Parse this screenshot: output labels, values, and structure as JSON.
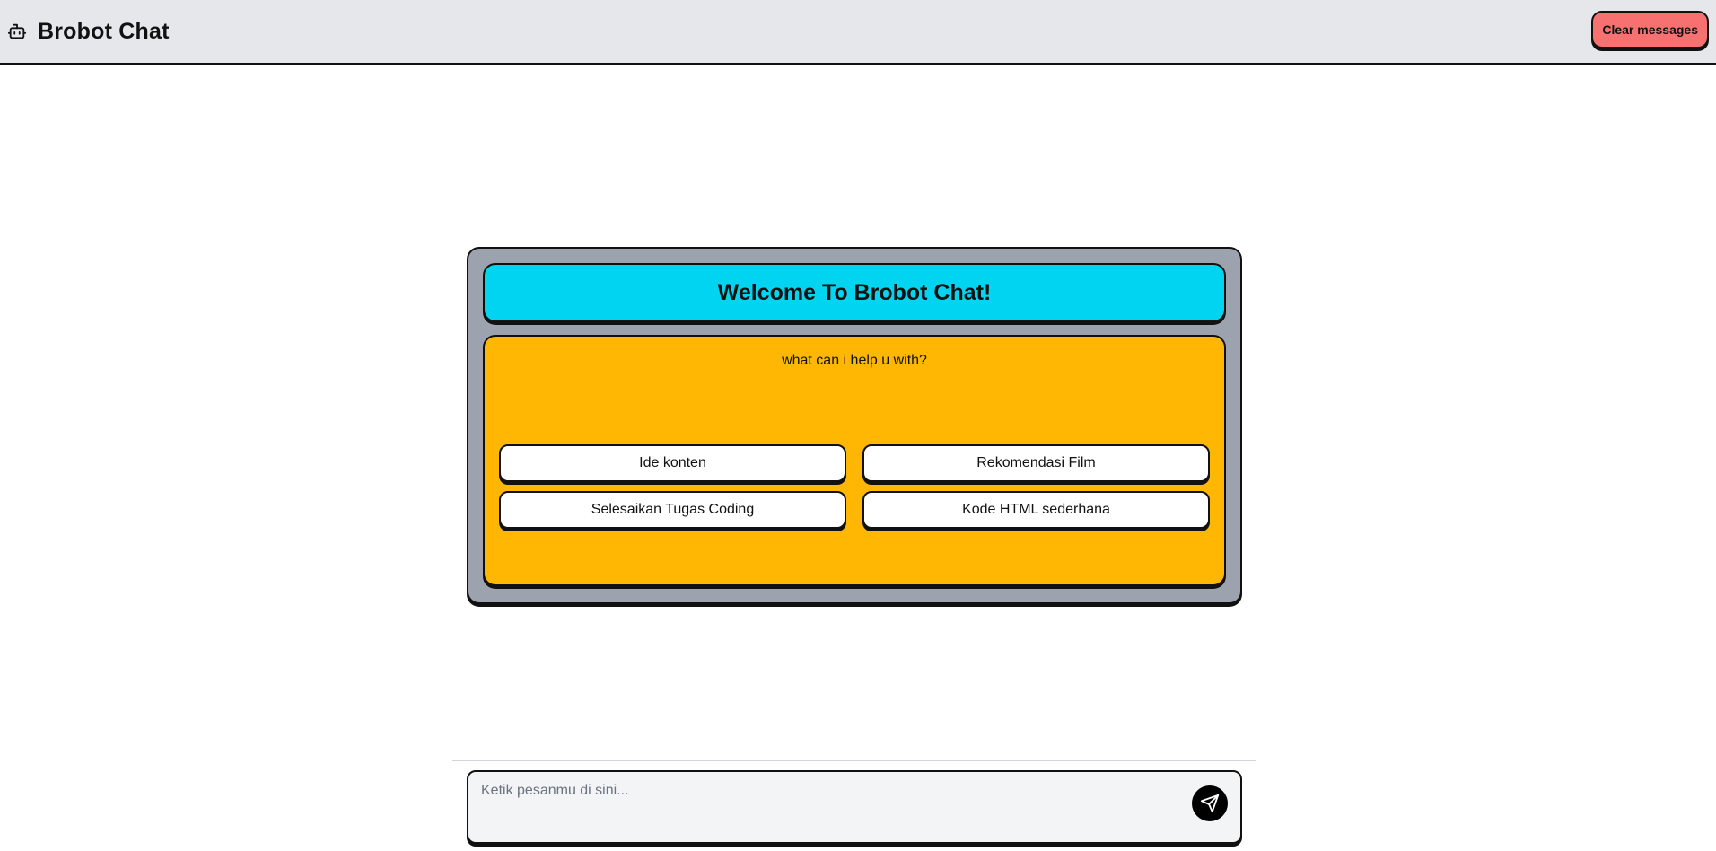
{
  "header": {
    "title": "Brobot Chat",
    "brand_icon": "robot-icon",
    "clear_label": "Clear messages",
    "clear_color": "#f87171"
  },
  "welcome": {
    "title": "Welcome To Brobot Chat!",
    "question": "what can i help u with?",
    "suggestions": [
      "Ide konten",
      "Rekomendasi Film",
      "Selesaikan Tugas Coding",
      "Kode HTML sederhana"
    ]
  },
  "composer": {
    "placeholder": "Ketik pesanmu di sini...",
    "value": "",
    "send_icon": "send-icon"
  },
  "colors": {
    "header_bg": "#e5e7eb",
    "panel_bg": "#9ca3af",
    "welcome_bg": "#00d4f0",
    "prompt_bg": "#ffb703",
    "button_bg": "#ffffff"
  }
}
